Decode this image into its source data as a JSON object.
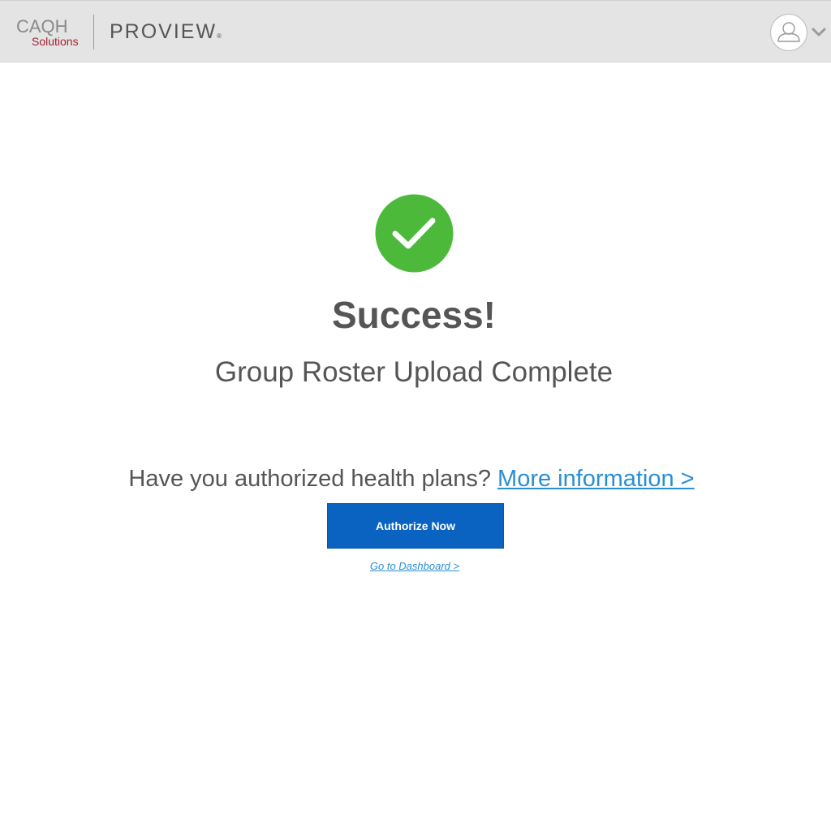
{
  "header": {
    "logo_caqh": "CAQH",
    "logo_solutions": "Solutions",
    "logo_proview": "PROVIEW",
    "logo_registered": "®"
  },
  "icons": {
    "user_avatar": "user-icon",
    "dropdown": "chevron-down-icon",
    "success": "checkmark-circle-icon"
  },
  "colors": {
    "success_green": "#4cb93b",
    "primary_blue": "#0a63c0",
    "link_blue": "#2a8fd4",
    "brand_red": "#a32030"
  },
  "main": {
    "title": "Success!",
    "subtitle": "Group Roster Upload Complete",
    "question": "Have you authorized health plans?",
    "more_info_link": "More information >",
    "authorize_button": "Authorize Now",
    "dashboard_link": "Go to Dashboard >"
  }
}
